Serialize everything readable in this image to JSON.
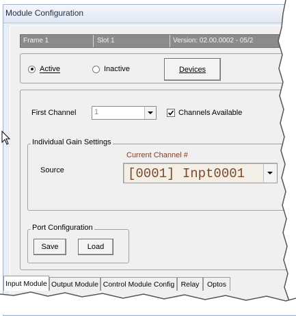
{
  "window": {
    "title": "Module Configuration"
  },
  "info_bar": {
    "frame": "Frame 1",
    "slot": "Slot 1",
    "version": "Version: 02.00.0002 - 05/2"
  },
  "state": {
    "active_label": "Active",
    "inactive_label": "Inactive",
    "selected": "Active",
    "devices_button": "Devices"
  },
  "channels": {
    "first_channel_label": "First Channel",
    "first_channel_value": "1",
    "channels_available_label": "Channels Available",
    "channels_available_checked": true
  },
  "gain": {
    "group_label": "Individual Gain Settings",
    "source_label": "Source",
    "current_channel_label": "Current Channel #",
    "current_channel_value": "[0001] Inpt0001",
    "accent_color": "#8b3a1a"
  },
  "port": {
    "group_label": "Port Configuration",
    "save_button": "Save",
    "load_button": "Load"
  },
  "tabs": [
    {
      "label": "Input Module",
      "active": true
    },
    {
      "label": "Output Module",
      "active": false
    },
    {
      "label": "Control Module Config",
      "active": false
    },
    {
      "label": "Relay",
      "active": false
    },
    {
      "label": "Optos",
      "active": false
    }
  ]
}
